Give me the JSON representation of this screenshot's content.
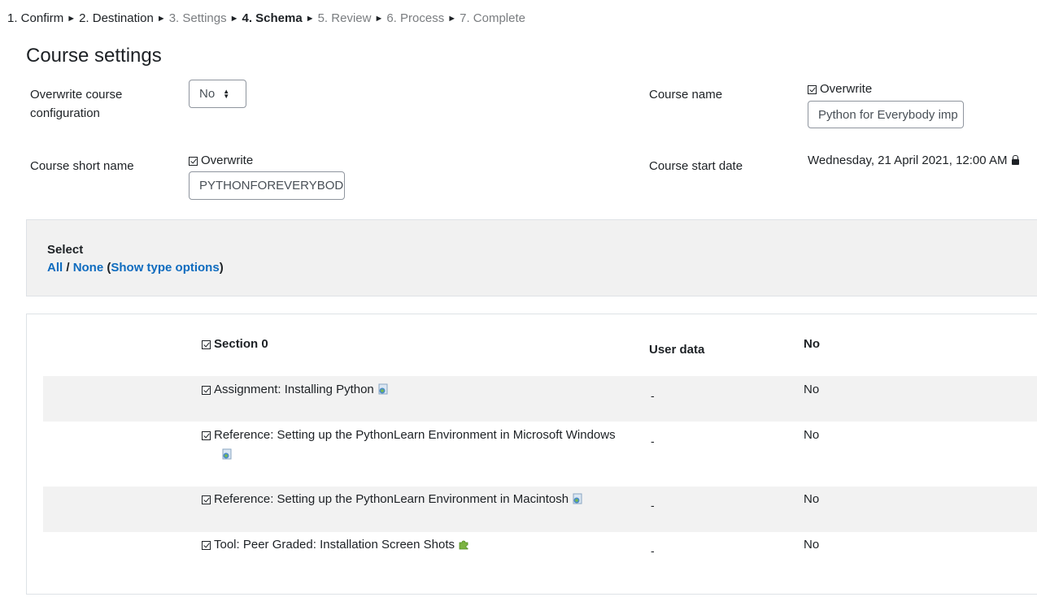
{
  "breadcrumb": {
    "steps": [
      {
        "label": "1. Confirm",
        "state": "done"
      },
      {
        "label": "2. Destination",
        "state": "done"
      },
      {
        "label": "3. Settings",
        "state": "future"
      },
      {
        "label": "4. Schema",
        "state": "current"
      },
      {
        "label": "5. Review",
        "state": "future"
      },
      {
        "label": "6. Process",
        "state": "future"
      },
      {
        "label": "7. Complete",
        "state": "future"
      }
    ],
    "separator": "►"
  },
  "page_title": "Course settings",
  "settings": {
    "overwrite_config": {
      "label": "Overwrite course configuration",
      "value": "No"
    },
    "course_name": {
      "label": "Course name",
      "overwrite_label": "Overwrite",
      "value": "Python for Everybody imp"
    },
    "short_name": {
      "label": "Course short name",
      "overwrite_label": "Overwrite",
      "value": "PYTHONFOREVERYBODY"
    },
    "start_date": {
      "label": "Course start date",
      "value": "Wednesday, 21 April 2021, 12:00 AM"
    }
  },
  "select_panel": {
    "title": "Select",
    "all": "All",
    "slash": " / ",
    "none": "None",
    "open_paren": " (",
    "show_type_options": "Show type options",
    "close_paren": ")"
  },
  "section": {
    "title": "Section 0",
    "user_data_header": "User data",
    "user_data_value": "No",
    "items": [
      {
        "label": "Assignment: Installing Python",
        "user_data": "-",
        "value": "No",
        "icon": "url-activity-icon"
      },
      {
        "label": "Reference: Setting up the PythonLearn Environment in Microsoft Windows",
        "user_data": "-",
        "value": "No",
        "icon": "url-activity-icon"
      },
      {
        "label": "Reference: Setting up the PythonLearn Environment in Macintosh",
        "user_data": "-",
        "value": "No",
        "icon": "url-activity-icon"
      },
      {
        "label": "Tool: Peer Graded: Installation Screen Shots",
        "user_data": "-",
        "value": "No",
        "icon": "lti-puzzle-icon"
      }
    ]
  },
  "colors": {
    "link": "#0f6cbf",
    "panel_bg": "#f1f1f1",
    "row_band": "#f2f2f2"
  }
}
